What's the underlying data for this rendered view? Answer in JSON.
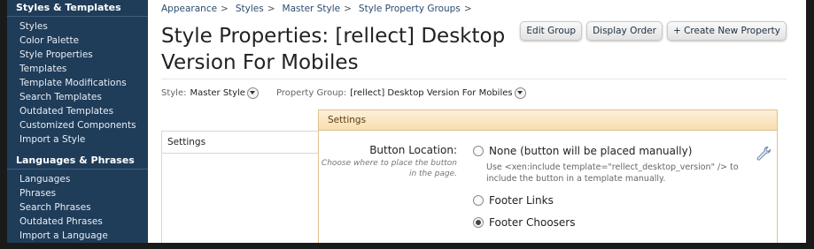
{
  "sidebar": {
    "sections": [
      {
        "heading": "Styles & Templates",
        "items": [
          "Styles",
          "Color Palette",
          "Style Properties",
          "Templates",
          "Template Modifications",
          "Search Templates",
          "Outdated Templates",
          "Customized Components",
          "Import a Style"
        ]
      },
      {
        "heading": "Languages & Phrases",
        "items": [
          "Languages",
          "Phrases",
          "Search Phrases",
          "Outdated Phrases",
          "Import a Language"
        ]
      }
    ]
  },
  "breadcrumb": [
    "Appearance",
    "Styles",
    "Master Style",
    "Style Property Groups"
  ],
  "breadcrumb_sep": ">",
  "page_title": "Style Properties: [rellect] Desktop Version For Mobiles",
  "buttons": {
    "edit_group": "Edit Group",
    "display_order": "Display Order",
    "create_property": "+ Create New Property"
  },
  "filters": {
    "style_label": "Style:",
    "style_value": "Master Style",
    "group_label": "Property Group:",
    "group_value": "[rellect] Desktop Version For Mobiles"
  },
  "tabs": [
    "Settings"
  ],
  "panel": {
    "title": "Settings",
    "field_label": "Button Location:",
    "field_hint": "Choose where to place the button in the page.",
    "options": [
      {
        "label": "None (button will be placed manually)",
        "selected": false
      },
      {
        "label": "Footer Links",
        "selected": false
      },
      {
        "label": "Footer Choosers",
        "selected": true
      }
    ],
    "option_note": "Use <xen:include template=\"rellect_desktop_version\" /> to include the button in a template manually."
  }
}
